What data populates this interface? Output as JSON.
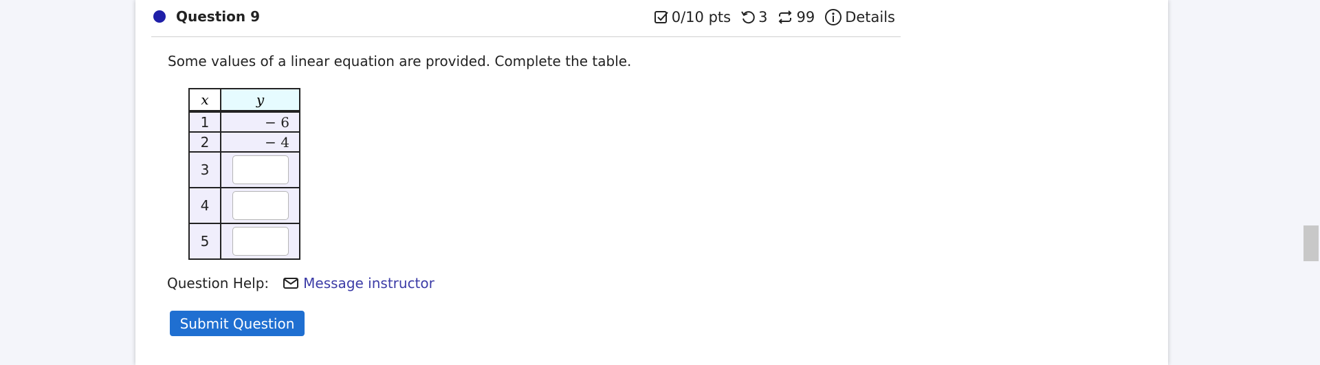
{
  "question": {
    "title": "Question 9",
    "points": "0/10 pts",
    "attempts": "3",
    "versions": "99",
    "details_label": "Details",
    "prompt": "Some values of a linear equation are provided. Complete the table."
  },
  "table": {
    "headers": [
      "x",
      "y"
    ],
    "given_rows": [
      {
        "x": "1",
        "y": "− 6"
      },
      {
        "x": "2",
        "y": "− 4"
      }
    ],
    "input_rows": [
      {
        "x": "3",
        "value": ""
      },
      {
        "x": "4",
        "value": ""
      },
      {
        "x": "5",
        "value": ""
      }
    ]
  },
  "help": {
    "label": "Question Help:",
    "link": "Message instructor"
  },
  "submit_label": "Submit Question",
  "colors": {
    "accent": "#1f6fd1",
    "link": "#3b3ba6",
    "status_dot": "#1f1fa8"
  },
  "icons": [
    "status-dot-icon",
    "checkbox-icon",
    "retry-icon",
    "repeat-icon",
    "info-icon",
    "mail-icon"
  ]
}
